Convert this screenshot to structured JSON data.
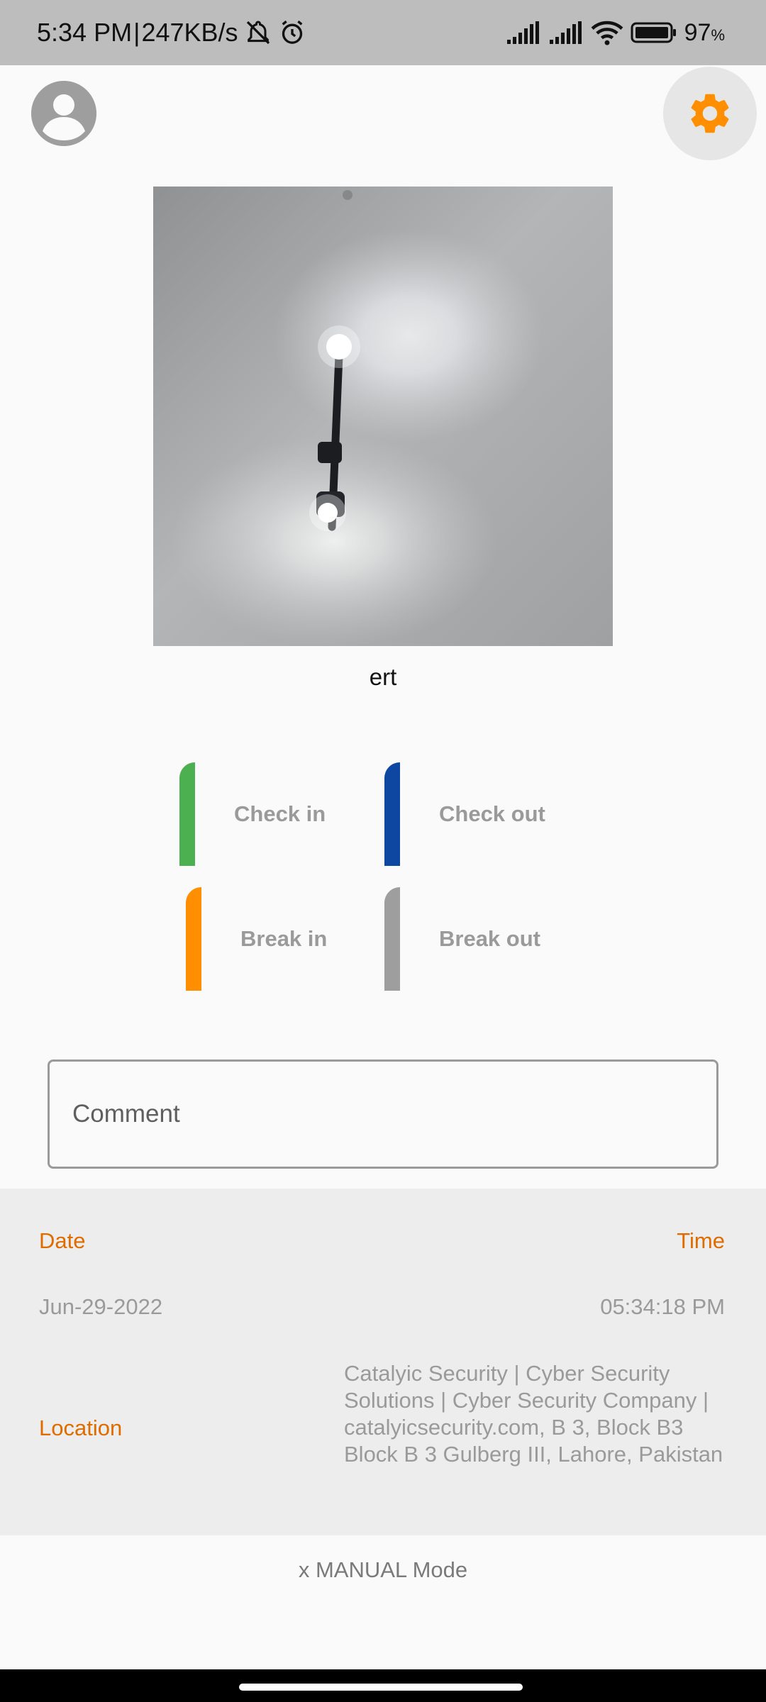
{
  "status_bar": {
    "time": "5:34 PM",
    "separator": "|",
    "speed": "247KB/s",
    "battery_percent": "97",
    "battery_unit": "%",
    "icons": [
      "mute-icon",
      "alarm-icon",
      "signal-icon",
      "signal-icon",
      "wifi-icon",
      "battery-icon"
    ]
  },
  "header": {
    "profile_icon": "account-circle-icon",
    "settings_icon": "gear-icon",
    "accent_color": "#FF8F00"
  },
  "photo": {
    "caption": "ert"
  },
  "actions": [
    {
      "label": "Check in",
      "color": "#4CAF50"
    },
    {
      "label": "Check out",
      "color": "#0D47A1"
    },
    {
      "label": "Break in",
      "color": "#FF8F00"
    },
    {
      "label": "Break out",
      "color": "#9E9E9E"
    }
  ],
  "comment": {
    "placeholder": "Comment"
  },
  "info": {
    "date_label": "Date",
    "time_label": "Time",
    "date_value": "Jun-29-2022",
    "time_value": "05:34:18 PM",
    "location_label": "Location",
    "location_value": "Catalyic Security | Cyber Security Solutions | Cyber Security Company | catalyicsecurity.com, B 3, Block B3 Block B 3 Gulberg III, Lahore, Pakistan"
  },
  "footer": {
    "mode_text": "x MANUAL Mode"
  }
}
